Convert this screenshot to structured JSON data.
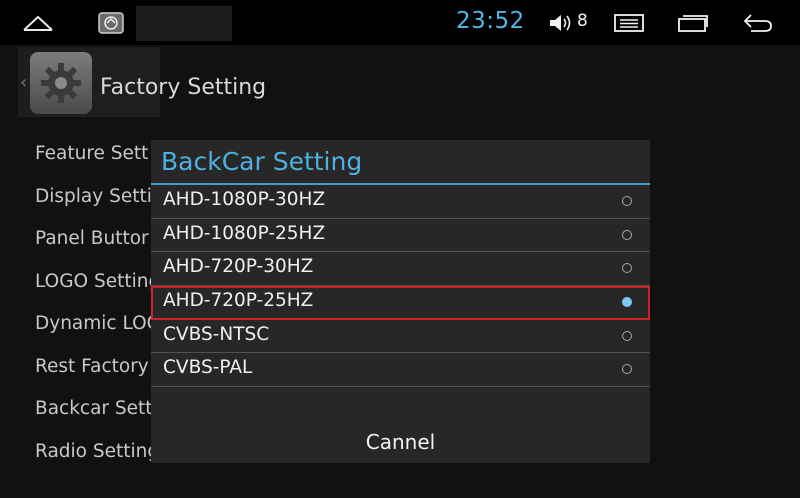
{
  "status_bar": {
    "time": "23:52",
    "volume_level": "8",
    "icons": [
      "home-icon",
      "app-icon",
      "volume-icon",
      "menu-icon",
      "recent-apps-icon",
      "back-icon"
    ]
  },
  "page": {
    "title": "Factory Setting",
    "icon": "gear-icon",
    "menu_items": [
      {
        "label": "Feature Sett"
      },
      {
        "label": "Display Setti"
      },
      {
        "label": "Panel Buttor"
      },
      {
        "label": "LOGO Setting"
      },
      {
        "label": "Dynamic LOC"
      },
      {
        "label": "Rest Factory"
      },
      {
        "label": "Backcar Sett"
      },
      {
        "label": "Radio Setting"
      }
    ]
  },
  "dialog": {
    "title": "BackCar Setting",
    "options": [
      {
        "label": "AHD-1080P-30HZ",
        "selected": false
      },
      {
        "label": "AHD-1080P-25HZ",
        "selected": false
      },
      {
        "label": "AHD-720P-30HZ",
        "selected": false
      },
      {
        "label": "AHD-720P-25HZ",
        "selected": true
      },
      {
        "label": "CVBS-NTSC",
        "selected": false
      },
      {
        "label": "CVBS-PAL",
        "selected": false
      }
    ],
    "cancel_label": "Cannel"
  },
  "colors": {
    "accent": "#4fb0e0",
    "selection_outline": "#d21f26",
    "radio_checked": "#7cc8ee"
  }
}
